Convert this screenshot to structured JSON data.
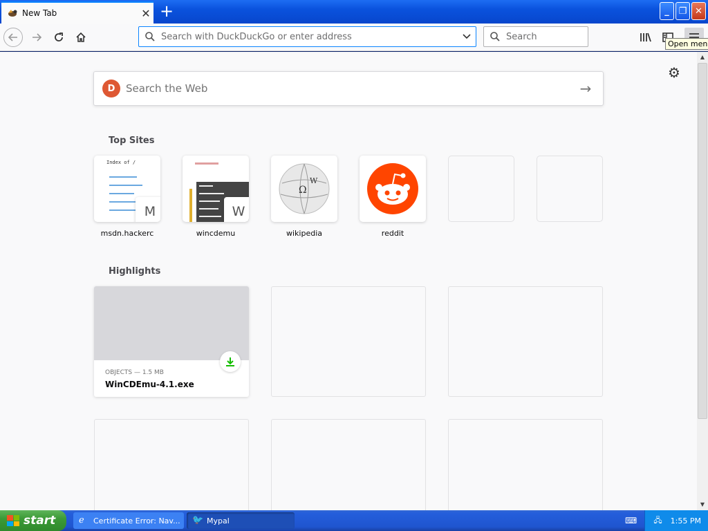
{
  "tab": {
    "title": "New Tab"
  },
  "toolbar": {
    "url_placeholder": "Search with DuckDuckGo or enter address",
    "search_placeholder": "Search"
  },
  "tooltip": "Open menu",
  "content": {
    "websearch_placeholder": "Search the Web",
    "top_sites_title": "Top Sites",
    "top_sites": [
      {
        "label": "msdn.hackerc",
        "mini": "M"
      },
      {
        "label": "wincdemu",
        "mini": "W"
      },
      {
        "label": "wikipedia"
      },
      {
        "label": "reddit"
      }
    ],
    "highlights_title": "Highlights",
    "highlight": {
      "meta": "OBJECTS — 1.5 MB",
      "filename": "WinCDEmu-4.1.exe"
    }
  },
  "taskbar": {
    "start": "start",
    "tasks": [
      "Certificate Error: Nav...",
      "Mypal"
    ],
    "clock": "1:55 PM"
  }
}
